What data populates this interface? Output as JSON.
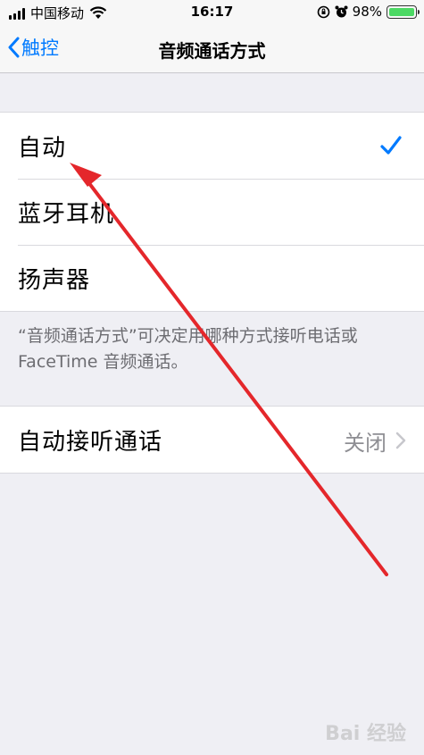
{
  "status_bar": {
    "carrier": "中国移动",
    "time": "16:17",
    "battery_percent": "98%"
  },
  "nav": {
    "back_label": "触控",
    "title": "音频通话方式"
  },
  "routing_options": [
    {
      "label": "自动",
      "selected": true
    },
    {
      "label": "蓝牙耳机",
      "selected": false
    },
    {
      "label": "扬声器",
      "selected": false
    }
  ],
  "routing_note": "“音频通话方式”可决定用哪种方式接听电话或 FaceTime 音频通话。",
  "auto_answer": {
    "label": "自动接听通话",
    "value": "关闭"
  },
  "watermark": "Bai 经验",
  "colors": {
    "accent": "#007aff",
    "annotation_arrow": "#e4272b",
    "battery": "#4cd964"
  }
}
